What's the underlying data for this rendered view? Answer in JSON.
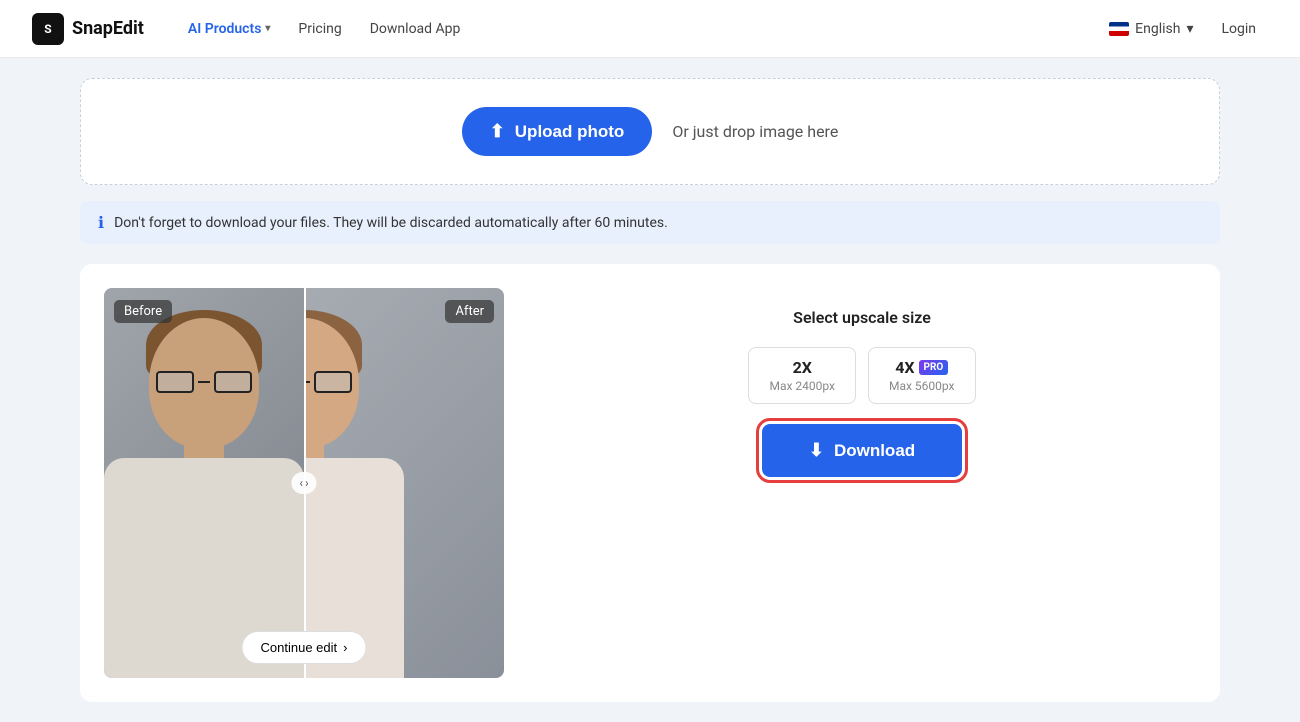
{
  "navbar": {
    "logo_text": "SnapEdit",
    "nav_items": [
      {
        "label": "AI Products",
        "active": true,
        "has_chevron": true
      },
      {
        "label": "Pricing",
        "active": false,
        "has_chevron": false
      },
      {
        "label": "Download App",
        "active": false,
        "has_chevron": false
      }
    ],
    "language": "English",
    "login_label": "Login"
  },
  "upload": {
    "button_label": "Upload photo",
    "drop_text": "Or just drop image here"
  },
  "info_bar": {
    "message": "Don't forget to download your files. They will be discarded automatically after 60 minutes."
  },
  "comparison": {
    "before_label": "Before",
    "after_label": "After",
    "continue_edit_label": "Continue edit",
    "arrow_left": "‹",
    "arrow_right": "›"
  },
  "right_panel": {
    "select_size_label": "Select upscale size",
    "size_options": [
      {
        "label": "2X",
        "px": "Max 2400px",
        "is_pro": false
      },
      {
        "label": "4X",
        "px": "Max 5600px",
        "is_pro": true
      }
    ],
    "pro_badge_label": "PRO",
    "download_label": "Download"
  }
}
